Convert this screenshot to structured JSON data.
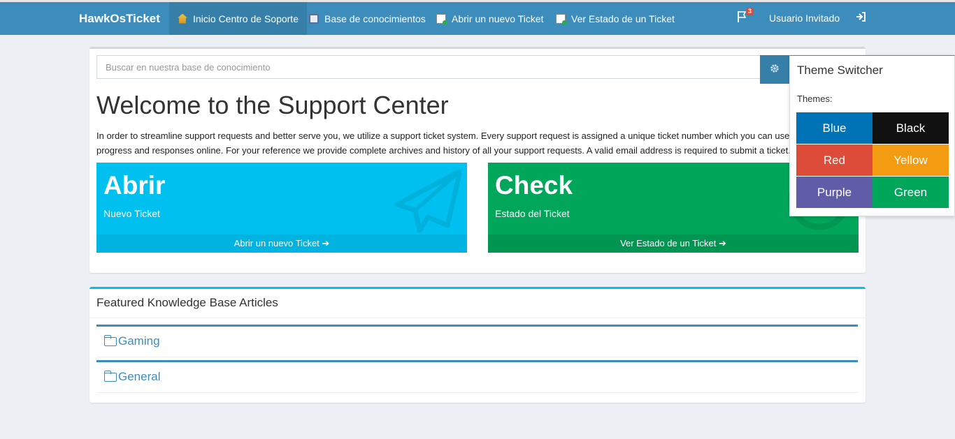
{
  "navbar": {
    "brand": "HawkOsTicket",
    "items": [
      {
        "label": "Inicio Centro de Soporte",
        "icon": "home-icon"
      },
      {
        "label": "Base de conocimientos",
        "icon": "book-icon"
      },
      {
        "label": "Abrir un nuevo Ticket",
        "icon": "new-ticket-icon"
      },
      {
        "label": "Ver Estado de un Ticket",
        "icon": "ticket-status-icon"
      }
    ],
    "notification_count": "3",
    "user_label": "Usuario Invitado"
  },
  "search": {
    "placeholder": "Buscar en nuestra base de conocimiento"
  },
  "welcome": {
    "title": "Welcome to the Support Center",
    "intro_line1": "In order to streamline support requests and better serve you, we utilize a support ticket system. Every support request is assigned a unique ticket number which you can use to track the",
    "intro_line2": "progress and responses online. For your reference we provide complete archives and history of all your support requests. A valid email address is required to submit a ticket."
  },
  "tiles": [
    {
      "big": "Abrir",
      "sub": "Nuevo Ticket",
      "footer": "Abrir un nuevo Ticket",
      "color": "#00c0ef"
    },
    {
      "big": "Check",
      "sub": "Estado del Ticket",
      "footer": "Ver Estado de un Ticket",
      "color": "#00a65a"
    }
  ],
  "kb": {
    "title": "Featured Knowledge Base Articles",
    "categories": [
      "Gaming",
      "General"
    ]
  },
  "theme_switcher": {
    "title": "Theme Switcher",
    "themes_label": "Themes:",
    "themes": [
      {
        "label": "Blue",
        "color": "#0073b7"
      },
      {
        "label": "Black",
        "color": "#111111"
      },
      {
        "label": "Red",
        "color": "#dd4b39"
      },
      {
        "label": "Yellow",
        "color": "#f39c12"
      },
      {
        "label": "Purple",
        "color": "#605ca8"
      },
      {
        "label": "Green",
        "color": "#00a65a"
      }
    ]
  }
}
